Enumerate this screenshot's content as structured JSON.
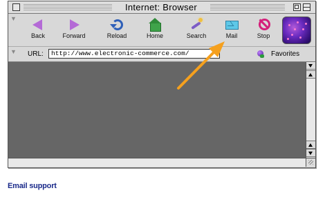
{
  "window": {
    "title": "Internet: Browser"
  },
  "toolbar": {
    "buttons": [
      {
        "label": "Back",
        "icon": "back-arrow-icon"
      },
      {
        "label": "Forward",
        "icon": "forward-arrow-icon"
      },
      {
        "label": "Reload",
        "icon": "reload-icon"
      },
      {
        "label": "Home",
        "icon": "home-icon"
      },
      {
        "label": "Search",
        "icon": "search-wand-icon"
      },
      {
        "label": "Mail",
        "icon": "mail-envelope-icon"
      },
      {
        "label": "Stop",
        "icon": "stop-icon"
      }
    ]
  },
  "location": {
    "label": "URL:",
    "url": "http://www.electronic-commerce.com/",
    "favorites_label": "Favorites"
  },
  "caption": "Email support",
  "colors": {
    "callout": "#f5a01e",
    "caption": "#1a2a8a",
    "content_bg": "#666666"
  }
}
